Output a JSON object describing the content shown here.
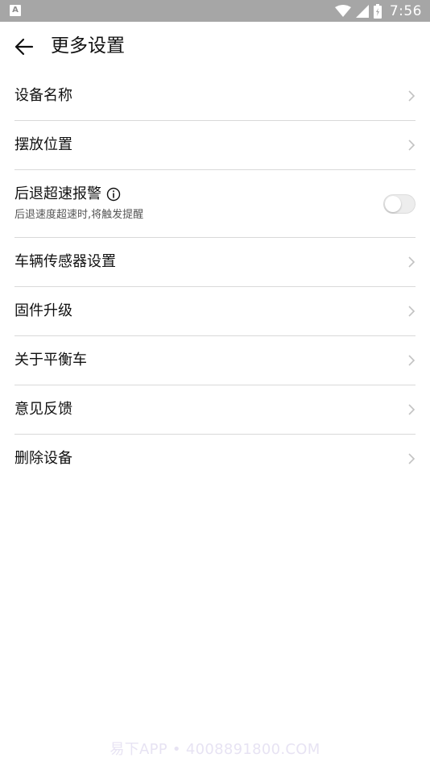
{
  "status_bar": {
    "app_badge": "A",
    "time": "7:56",
    "icons": [
      "wifi-icon",
      "cell-signal-icon",
      "battery-icon"
    ],
    "background": "#a6a6a6"
  },
  "header": {
    "back_icon": "arrow-left-icon",
    "title": "更多设置"
  },
  "menu": {
    "items": [
      {
        "label": "设备名称"
      },
      {
        "label": "摆放位置"
      },
      {
        "label": "后退超速报警",
        "subtitle": "后退速度超速时,将触发提醒",
        "info_icon": "info-icon",
        "toggle_on": false
      },
      {
        "label": "车辆传感器设置"
      },
      {
        "label": "固件升级"
      },
      {
        "label": "关于平衡车"
      },
      {
        "label": "意见反馈"
      },
      {
        "label": "删除设备"
      }
    ]
  },
  "watermark": "易下APP • 4008891800.COM"
}
